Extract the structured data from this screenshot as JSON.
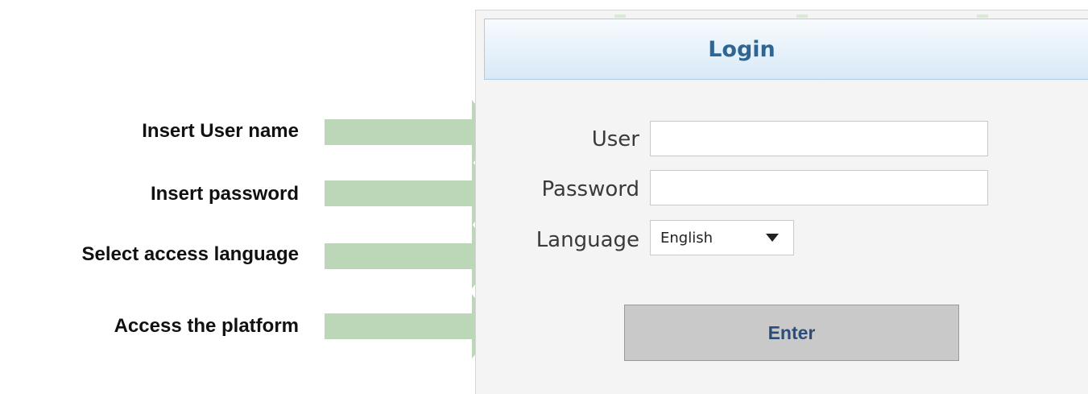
{
  "annotations": [
    {
      "text": "Insert User name"
    },
    {
      "text": "Insert password"
    },
    {
      "text": "Select access language"
    },
    {
      "text": "Access the platform"
    }
  ],
  "login": {
    "title": "Login",
    "user_label": "User",
    "user_value": "",
    "password_label": "Password",
    "password_value": "",
    "language_label": "Language",
    "language_selected": "English",
    "enter_label": "Enter"
  },
  "colors": {
    "arrow": "#bcd6b8",
    "title_text": "#2f6593",
    "button_text": "#2a4d79",
    "button_bg": "#c9c9c9"
  },
  "icons": {
    "arrow": "right-arrow-icon",
    "caret": "caret-down-icon"
  }
}
